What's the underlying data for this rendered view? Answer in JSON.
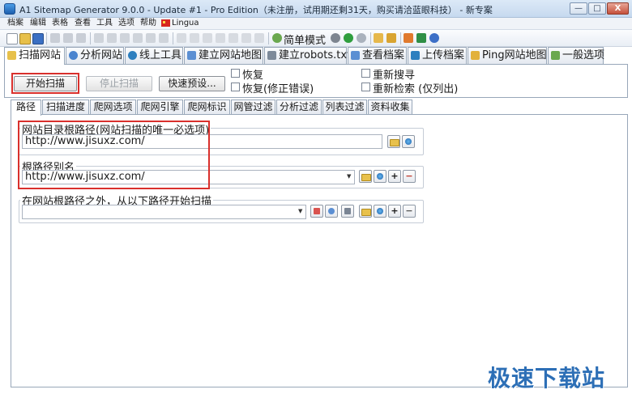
{
  "window": {
    "title": "A1 Sitemap Generator 9.0.0 - Update #1 - Pro Edition（未注册，试用期还剩31天，购买请洽蓝眼科技） - 新专案",
    "minimize": "—",
    "maximize": "□",
    "close": "X"
  },
  "menu": [
    "档案",
    "编辑",
    "表格",
    "查看",
    "工具",
    "选项",
    "帮助",
    "Lingua"
  ],
  "toolbar": {
    "simple_mode": "简单模式"
  },
  "main_tabs": [
    "扫描网站",
    "分析网站",
    "线上工具",
    "建立网站地图",
    "建立robots.txt",
    "查看档案",
    "上传档案",
    "Ping网站地图",
    "一般选项"
  ],
  "scan": {
    "start": "开始扫描",
    "stop": "停止扫描",
    "quick_preset": "快速预设...",
    "options": [
      "恢复",
      "恢复(修正错误)",
      "重新搜寻",
      "重新检索 (仅列出)"
    ]
  },
  "sub_tabs": [
    "路径",
    "扫描进度",
    "爬网选项",
    "爬网引擎",
    "爬网标识",
    "网管过滤",
    "分析过滤",
    "列表过滤",
    "资料收集"
  ],
  "path": {
    "root_label": "网站目录根路径(网站扫描的唯一必选项)",
    "root_value": "http://www.jisuxz.com/",
    "alias_label": "根路径别名",
    "alias_value": "http://www.jisuxz.com/",
    "outside_label": "在网站根路径之外，从以下路径开始扫描",
    "outside_value": ""
  },
  "watermark": "极速下载站",
  "colors": {
    "highlight": "#d9302c",
    "accent": "#2d6fb6"
  }
}
